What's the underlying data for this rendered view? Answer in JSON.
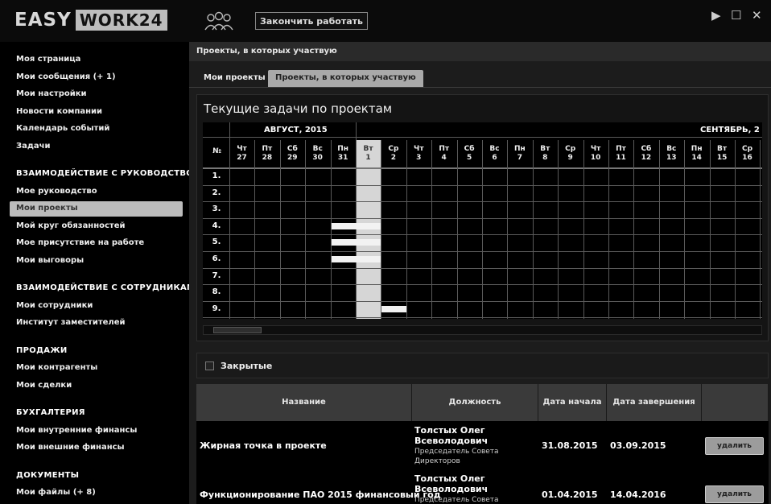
{
  "app": {
    "logo_easy": "EASY",
    "logo_work": "WORK24",
    "finish_label": "Закончить работать",
    "controls": [
      "▶",
      "☐",
      "✕"
    ]
  },
  "sidebar": {
    "items_top": [
      "Моя страница",
      "Мои сообщения (+ 1)",
      "Мои настройки",
      "Новости компании",
      "Календарь событий",
      "Задачи"
    ],
    "head_management": "ВЗАИМОДЕЙСТВИЕ С РУКОВОДСТВОМ",
    "items_management": [
      "Мое руководство",
      "Мои проекты",
      "Мой круг обязанностей",
      "Мое присутствие на работе",
      "Мои выговоры"
    ],
    "head_staff": "ВЗАИМОДЕЙСТВИЕ С СОТРУДНИКАМИ",
    "items_staff": [
      "Мои сотрудники",
      "Институт заместителей"
    ],
    "head_sales": "ПРОДАЖИ",
    "items_sales": [
      "Мои контрагенты",
      "Мои сделки"
    ],
    "head_accounting": "БУХГАЛТЕРИЯ",
    "items_accounting": [
      "Мои внутренние финансы",
      "Мои внешние финансы"
    ],
    "head_docs": "ДОКУМЕНТЫ",
    "items_docs": [
      "Мои файлы (+ 8)"
    ]
  },
  "main": {
    "header": "Проекты, в которых участвую",
    "tabs": [
      "Мои проекты",
      "Проекты, в которых участвую"
    ],
    "panel_title": "Текущие задачи по проектам",
    "month_1": "АВГУСТ, 2015",
    "month_2": "СЕНТЯБРЬ, 2",
    "row_header": "№",
    "days": [
      {
        "wd": "Чт",
        "d": "27"
      },
      {
        "wd": "Пт",
        "d": "28"
      },
      {
        "wd": "Сб",
        "d": "29"
      },
      {
        "wd": "Вс",
        "d": "30"
      },
      {
        "wd": "Пн",
        "d": "31"
      },
      {
        "wd": "Вт",
        "d": "1"
      },
      {
        "wd": "Ср",
        "d": "2"
      },
      {
        "wd": "Чт",
        "d": "3"
      },
      {
        "wd": "Пт",
        "d": "4"
      },
      {
        "wd": "Сб",
        "d": "5"
      },
      {
        "wd": "Вс",
        "d": "6"
      },
      {
        "wd": "Пн",
        "d": "7"
      },
      {
        "wd": "Вт",
        "d": "8"
      },
      {
        "wd": "Ср",
        "d": "9"
      },
      {
        "wd": "Чт",
        "d": "10"
      },
      {
        "wd": "Пт",
        "d": "11"
      },
      {
        "wd": "Сб",
        "d": "12"
      },
      {
        "wd": "Вс",
        "d": "13"
      },
      {
        "wd": "Пн",
        "d": "14"
      },
      {
        "wd": "Вт",
        "d": "15"
      },
      {
        "wd": "Ср",
        "d": "16"
      }
    ],
    "rows": [
      "1.",
      "2.",
      "3.",
      "4.",
      "5.",
      "6.",
      "7.",
      "8.",
      "9."
    ],
    "closed_label": "Закрытые",
    "table_headers": [
      "Название",
      "Должность",
      "Дата начала",
      "Дата завершения",
      ""
    ],
    "table_rows": [
      {
        "name": "Жирная точка в проекте",
        "person": "Толстых Олег Всеволодович",
        "role": "Председатель Совета Директоров",
        "start": "31.08.2015",
        "end": "03.09.2015",
        "action": "удалить"
      },
      {
        "name": "Функционирование ПАО 2015 финансовый год",
        "person": "Толстых Олег Всеволодович",
        "role": "Председатель Совета",
        "start": "01.04.2015",
        "end": "14.04.2016",
        "action": "удалить"
      }
    ]
  }
}
